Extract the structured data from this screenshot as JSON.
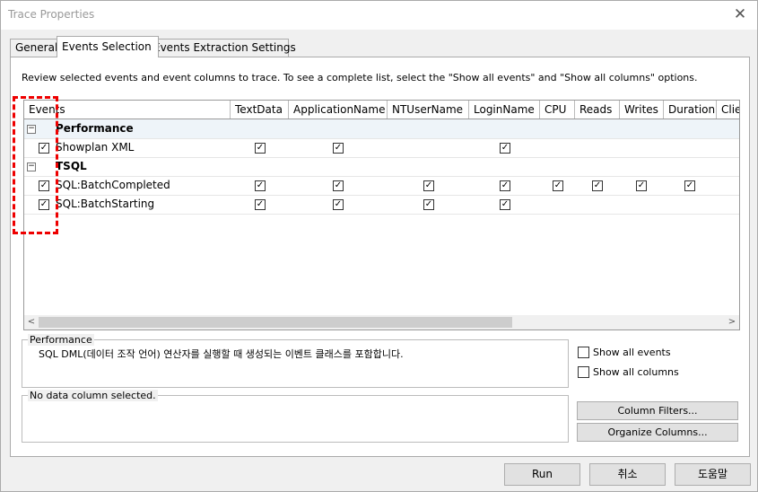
{
  "window": {
    "title": "Trace Properties",
    "close_glyph": "✕"
  },
  "tabs": [
    {
      "label": "General"
    },
    {
      "label": "Events Selection"
    },
    {
      "label": "Events Extraction Settings"
    }
  ],
  "description": "Review selected events and event columns to trace. To see a complete list, select the \"Show all events\" and \"Show all columns\" options.",
  "grid": {
    "columns": [
      "Events",
      "TextData",
      "ApplicationName",
      "NTUserName",
      "LoginName",
      "CPU",
      "Reads",
      "Writes",
      "Duration",
      "Clie"
    ],
    "categories": [
      {
        "name": "Performance",
        "expander": "−"
      },
      {
        "name": "TSQL",
        "expander": "−"
      }
    ],
    "events": [
      {
        "name": "Showplan XML",
        "checked": true
      },
      {
        "name": "SQL:BatchCompleted",
        "checked": true
      },
      {
        "name": "SQL:BatchStarting",
        "checked": true
      }
    ],
    "checkmark": "✓",
    "scroll_left": "<",
    "scroll_right": ">"
  },
  "perf_group": {
    "legend": "Performance",
    "text": "SQL DML(데이터 조작 언어) 연산자를 실행할 때 생성되는 이벤트 클래스를 포함합니다."
  },
  "column_group": {
    "text": "No data column selected."
  },
  "options": {
    "show_all_events": {
      "label": "Show all events",
      "checked": false
    },
    "show_all_columns": {
      "label": "Show all columns",
      "checked": false
    }
  },
  "buttons": {
    "column_filters": "Column Filters...",
    "organize_columns": "Organize Columns...",
    "run": "Run",
    "cancel": "취소",
    "help": "도움말"
  },
  "colors": {
    "highlight_row": "#eef4f9",
    "annotation": "#e00000"
  }
}
